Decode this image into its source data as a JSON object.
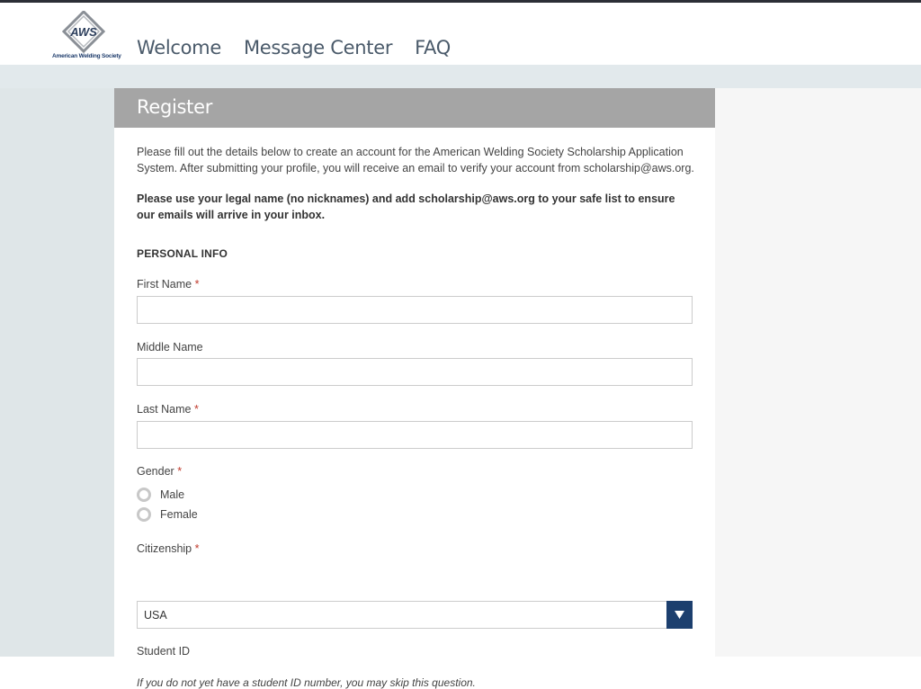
{
  "header": {
    "logo_text": "AWS",
    "logo_tagline": "American Welding Society",
    "nav": [
      {
        "label": "Welcome"
      },
      {
        "label": "Message Center"
      },
      {
        "label": "FAQ"
      }
    ]
  },
  "card": {
    "title": "Register",
    "intro": "Please fill out the details below to create an account for the American Welding Society Scholarship Application System. After submitting your profile, you will receive an email to verify your account from scholarship@aws.org.",
    "notice": "Please use your legal name (no nicknames) and add scholarship@aws.org to your safe list to ensure our emails will arrive in your inbox.",
    "section_title": "PERSONAL INFO",
    "required_marker": "*",
    "fields": {
      "first_name": {
        "label": "First Name",
        "value": ""
      },
      "middle_name": {
        "label": "Middle Name",
        "value": ""
      },
      "last_name": {
        "label": "Last Name",
        "value": ""
      },
      "gender": {
        "label": "Gender",
        "options": [
          "Male",
          "Female"
        ]
      },
      "citizenship": {
        "label": "Citizenship",
        "selected": "USA"
      },
      "student_id": {
        "label": "Student ID",
        "hint": "If you do not yet have a student ID number, you may skip this question."
      }
    }
  },
  "colors": {
    "brand_navy": "#1c3f6e",
    "header_gray": "#a5a5a5",
    "required_red": "#c0392b"
  },
  "icons": {
    "logo": "aws-diamond-logo",
    "dropdown": "caret-down-icon"
  }
}
